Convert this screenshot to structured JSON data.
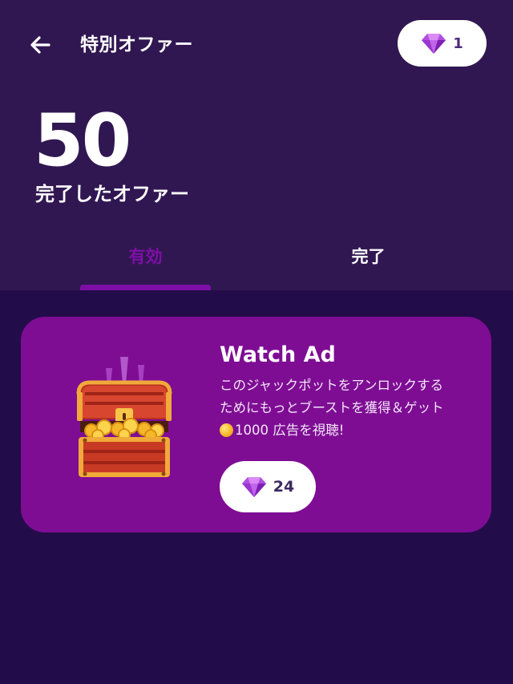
{
  "header": {
    "title": "特別オファー",
    "gem_balance": "1"
  },
  "stats": {
    "completed_count": "50",
    "completed_label": "完了したオファー"
  },
  "tabs": [
    {
      "label": "有効",
      "active": true
    },
    {
      "label": "完了",
      "active": false
    }
  ],
  "offer": {
    "title": "Watch Ad",
    "description_line1": "このジャックポットをアンロックする",
    "description_line2": "ためにもっとブーストを獲得＆ゲット",
    "reward_amount": "1000",
    "description_line3": " 広告を視聴!",
    "price": "24"
  },
  "colors": {
    "header_bg": "#311752",
    "page_bg": "#230c4a",
    "accent": "#7e0fa6",
    "card_bg": "#7e0d94",
    "gem": "#b04ee0"
  },
  "icons": {
    "back": "arrow-left-icon",
    "gem": "diamond-icon",
    "coin": "coin-icon",
    "chest": "treasure-chest-icon"
  }
}
